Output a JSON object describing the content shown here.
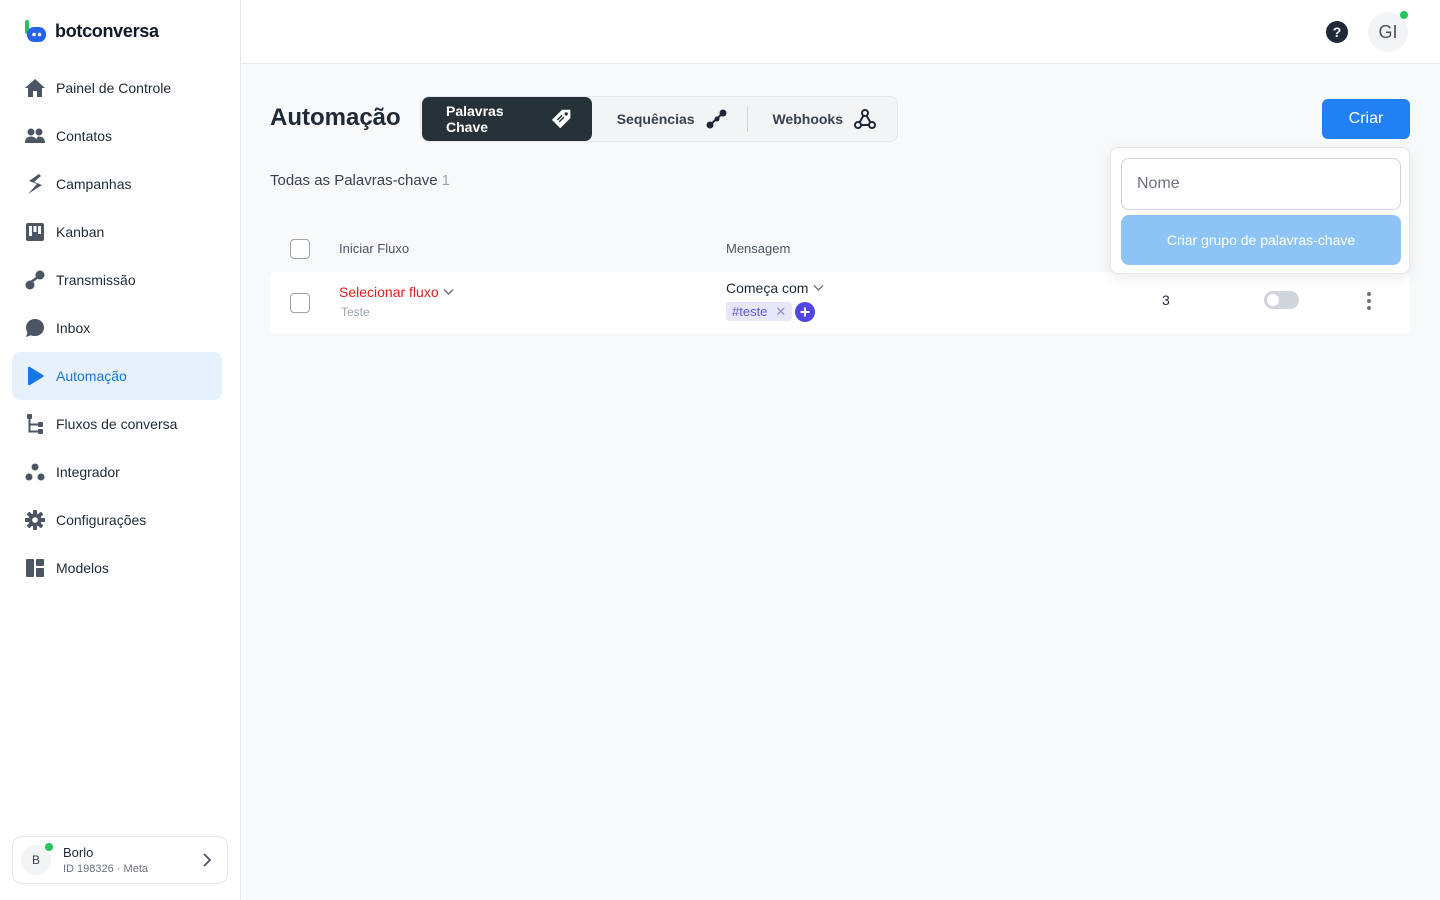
{
  "brand": {
    "name": "botconversa",
    "accent": "#2180f3"
  },
  "sidebar": {
    "items": [
      {
        "label": "Painel de Controle",
        "icon": "home-icon"
      },
      {
        "label": "Contatos",
        "icon": "users-icon"
      },
      {
        "label": "Campanhas",
        "icon": "campaign-icon"
      },
      {
        "label": "Kanban",
        "icon": "kanban-icon"
      },
      {
        "label": "Transmissão",
        "icon": "broadcast-icon"
      },
      {
        "label": "Inbox",
        "icon": "chat-bubble-icon"
      },
      {
        "label": "Automação",
        "icon": "automation-play-icon",
        "active": true
      },
      {
        "label": "Fluxos de conversa",
        "icon": "flow-tree-icon"
      },
      {
        "label": "Integrador",
        "icon": "integrator-icon"
      },
      {
        "label": "Configurações",
        "icon": "gear-icon"
      },
      {
        "label": "Modelos",
        "icon": "templates-icon"
      }
    ],
    "account": {
      "initial": "B",
      "name": "Borlo",
      "meta": "ID 198326 · Meta"
    }
  },
  "topbar": {
    "help": "?",
    "user_initials": "GI"
  },
  "main": {
    "title": "Automação",
    "tabs": [
      {
        "label": "Palavras Chave",
        "icon": "tag-icon",
        "active": true
      },
      {
        "label": "Sequências",
        "icon": "sequence-icon"
      },
      {
        "label": "Webhooks",
        "icon": "webhook-icon"
      }
    ],
    "create_label": "Criar",
    "list_title": "Todas as Palavras-chave",
    "list_count": "1",
    "columns": {
      "flow": "Iniciar Fluxo",
      "message": "Mensagem"
    },
    "rows": [
      {
        "flow": "Selecionar fluxo",
        "flow_sub": "Teste",
        "match": "Começa com",
        "tag": "#teste",
        "count": "3",
        "enabled": false
      }
    ]
  },
  "popover": {
    "name_placeholder": "Nome",
    "submit_label": "Criar grupo de palavras-chave"
  }
}
